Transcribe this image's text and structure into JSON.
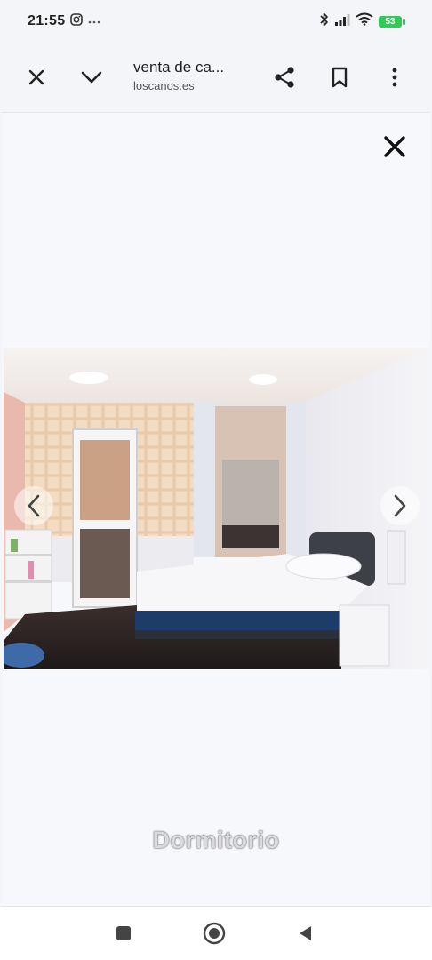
{
  "status_bar": {
    "time": "21:55",
    "battery_level": "53",
    "icons": [
      "instagram-icon",
      "more-dots-icon",
      "bluetooth-icon",
      "signal-icon",
      "wifi-icon",
      "battery-icon"
    ]
  },
  "toolbar": {
    "title": "venta de ca...",
    "url": "loscanos.es",
    "icons": [
      "close-icon",
      "chevron-down-icon",
      "share-icon",
      "bookmark-icon",
      "more-vert-icon"
    ]
  },
  "viewer": {
    "caption": "Dormitorio",
    "icons": [
      "close-icon",
      "chevron-left-icon",
      "chevron-right-icon"
    ]
  },
  "nav_bar": {
    "icons": [
      "recents-square-icon",
      "home-circle-icon",
      "back-triangle-icon"
    ]
  },
  "colors": {
    "page_background": "#f4f5f8",
    "battery_green": "#34c759",
    "icon_dark": "#222222"
  }
}
